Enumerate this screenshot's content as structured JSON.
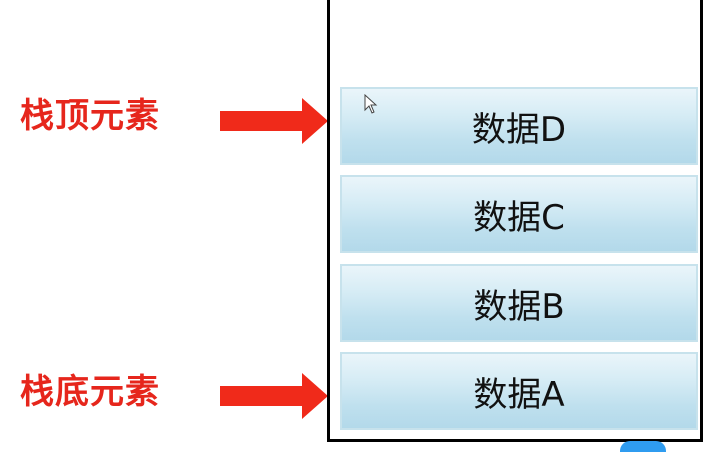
{
  "labels": {
    "top": "栈顶元素",
    "bottom": "栈底元素"
  },
  "stack": {
    "items": [
      {
        "label": "数据D"
      },
      {
        "label": "数据C"
      },
      {
        "label": "数据B"
      },
      {
        "label": "数据A"
      }
    ]
  },
  "colors": {
    "label_text": "#e6261c",
    "arrow": "#f02a1a",
    "cell_border": "#c7e2ec",
    "cell_fill": "#bfe0ee",
    "stack_border": "#000000"
  },
  "icons": {
    "arrow": "right-arrow-icon",
    "cursor": "mouse-pointer-icon"
  }
}
